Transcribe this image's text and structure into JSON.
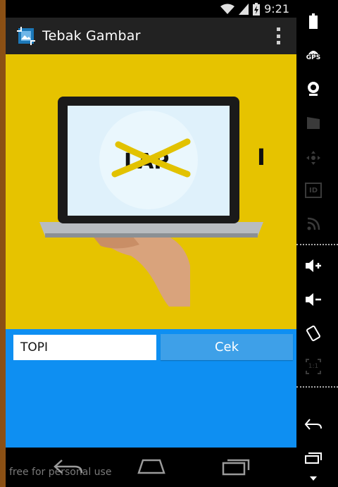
{
  "status_bar": {
    "time": "9:21",
    "icons": [
      "wifi-icon",
      "signal-icon",
      "battery-charging-icon"
    ]
  },
  "action_bar": {
    "title": "Tebak Gambar",
    "app_icon": "image-crop-icon",
    "menu_icon": "overflow-menu-icon"
  },
  "puzzle": {
    "crossed_text": "LAP",
    "hint_letter": "I",
    "colors": {
      "background": "#e6c300",
      "cross": "#e7c400"
    }
  },
  "answer": {
    "input_value": "TOPI",
    "button_label": "Cek",
    "colors": {
      "panel": "#0e8ff2",
      "button": "#3ea0e8"
    }
  },
  "nav_bar": {
    "watermark": "free for personal use",
    "buttons": [
      "back-icon",
      "home-icon",
      "recents-icon"
    ]
  },
  "side_panel": {
    "gps_label": "GPS",
    "id_label": "ID",
    "ratio_label": "1:1",
    "buttons": [
      "battery-icon",
      "gps-icon",
      "camera-icon",
      "clapperboard-icon",
      "dpad-icon",
      "id-icon",
      "rss-icon",
      "volume-up-icon",
      "volume-down-icon",
      "rotate-icon",
      "scale-icon",
      "back-icon",
      "recents-icon"
    ]
  }
}
